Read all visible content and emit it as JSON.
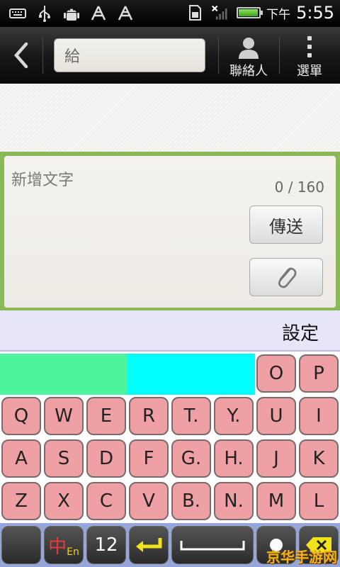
{
  "status_bar": {
    "time_prefix": "下午",
    "time": "5:55",
    "icons": [
      "keyboard-icon",
      "usb-icon",
      "android-debug-icon",
      "tower-icon",
      "tower-icon",
      "sd-card-icon",
      "signal-icon",
      "battery-icon"
    ]
  },
  "titlebar": {
    "to_value": "給",
    "contacts_label": "聯絡人",
    "menu_label": "選單"
  },
  "compose": {
    "placeholder": "新增文字",
    "counter": "0 / 160",
    "send_label": "傳送"
  },
  "settings": {
    "label": "設定"
  },
  "keyboard": {
    "row0": [
      "O",
      "P"
    ],
    "row1": [
      "Q",
      "W",
      "E",
      "R",
      "T.",
      "Y.",
      "U",
      "I"
    ],
    "row2": [
      "A",
      "S",
      "D",
      "F",
      "G.",
      "H.",
      "J",
      "K"
    ],
    "row3": [
      "Z",
      "X",
      "C",
      "V",
      "B.",
      "N.",
      "M",
      "L"
    ],
    "fn": {
      "lang_main": "中",
      "lang_sub": "En",
      "num_label": "12"
    }
  },
  "watermark": "京华手游网",
  "colors": {
    "key_pink": "#efa0a4",
    "candidate_green": "#4cf59d",
    "candidate_cyan": "#00ffff",
    "compose_border": "#8db85a",
    "settings_bg": "#e6e6f8",
    "fn_row_bg": "#96a6d8"
  }
}
